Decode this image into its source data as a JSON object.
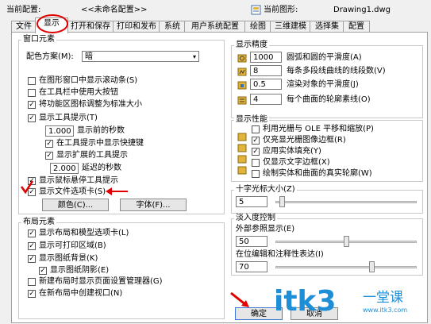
{
  "header": {
    "current_profile_label": "当前配置:",
    "current_profile_value": "<<未命名配置>>",
    "current_drawing_label": "当前图形:",
    "current_drawing_value": "Drawing1.dwg"
  },
  "tabs": [
    "文件",
    "显示",
    "打开和保存",
    "打印和发布",
    "系统",
    "用户系统配置",
    "绘图",
    "三维建模",
    "选择集",
    "配置"
  ],
  "window_elements": {
    "title": "窗口元素",
    "color_scheme_label": "配色方案(M):",
    "color_scheme_value": "暗",
    "checkboxes": [
      {
        "label": "在图形窗口中显示滚动条(S)",
        "checked": false
      },
      {
        "label": "在工具栏中使用大按钮",
        "checked": false
      },
      {
        "label": "将功能区图标调整为标准大小",
        "checked": true
      },
      {
        "label": "显示工具提示(T)",
        "checked": true
      }
    ],
    "delay_value": "1.000",
    "delay_label": "显示前的秒数",
    "show_shortcut": {
      "label": "在工具提示中显示快捷键",
      "checked": true
    },
    "show_extended": {
      "label": "显示扩展的工具提示",
      "checked": true
    },
    "extended_delay_value": "2.000",
    "extended_delay_label": "延迟的秒数",
    "rollover": {
      "label": "显示鼠标悬停工具提示",
      "checked": true
    },
    "file_tabs": {
      "label": "显示文件选项卡(S)",
      "checked": true
    },
    "colors_button": "颜色(C)...",
    "fonts_button": "字体(F)..."
  },
  "layout_elements": {
    "title": "布局元素",
    "checkboxes": [
      {
        "label": "显示布局和模型选项卡(L)",
        "checked": true
      },
      {
        "label": "显示可打印区域(B)",
        "checked": true
      },
      {
        "label": "显示图纸背景(K)",
        "checked": true
      }
    ],
    "paper_shadow": {
      "label": "显示图纸阴影(E)",
      "checked": true
    },
    "page_setup": {
      "label": "新建布局时显示页面设置管理器(G)",
      "checked": false
    },
    "create_viewport": {
      "label": "在新布局中创建视口(N)",
      "checked": true
    }
  },
  "display_resolution": {
    "title": "显示精度",
    "rows": [
      {
        "value": "1000",
        "label": "圆弧和圆的平滑度(A)"
      },
      {
        "value": "8",
        "label": "每条多段线曲线的线段数(V)"
      },
      {
        "value": "0.5",
        "label": "渲染对象的平滑度(J)"
      },
      {
        "value": "4",
        "label": "每个曲面的轮廓素线(O)"
      }
    ]
  },
  "display_performance": {
    "title": "显示性能",
    "rows": [
      {
        "label": "利用光栅与 OLE 平移和缩放(P)",
        "checked": false
      },
      {
        "label": "仅亮显光栅图像边框(R)",
        "checked": true
      },
      {
        "label": "应用实体填充(Y)",
        "checked": true
      },
      {
        "label": "仅显示文字边框(X)",
        "checked": false
      },
      {
        "label": "绘制实体和曲面的真实轮廓(W)",
        "checked": false
      }
    ]
  },
  "crosshair": {
    "title": "十字光标大小(Z)",
    "value": "5",
    "level": 5
  },
  "fade_control": {
    "title": "淡入度控制",
    "xref_label": "外部参照显示(E)",
    "xref_value": "50",
    "inplace_label": "在位编辑和注释性表达(I)",
    "inplace_value": "70"
  },
  "footer": {
    "ok_button": "确定",
    "cancel_button": "取消"
  },
  "watermark": {
    "text": "itk3",
    "subtext": "一堂课",
    "url": "www.itk3.com"
  },
  "colors": {
    "accent_red": "#e00000",
    "watermark_blue": "#1e8fd6"
  }
}
